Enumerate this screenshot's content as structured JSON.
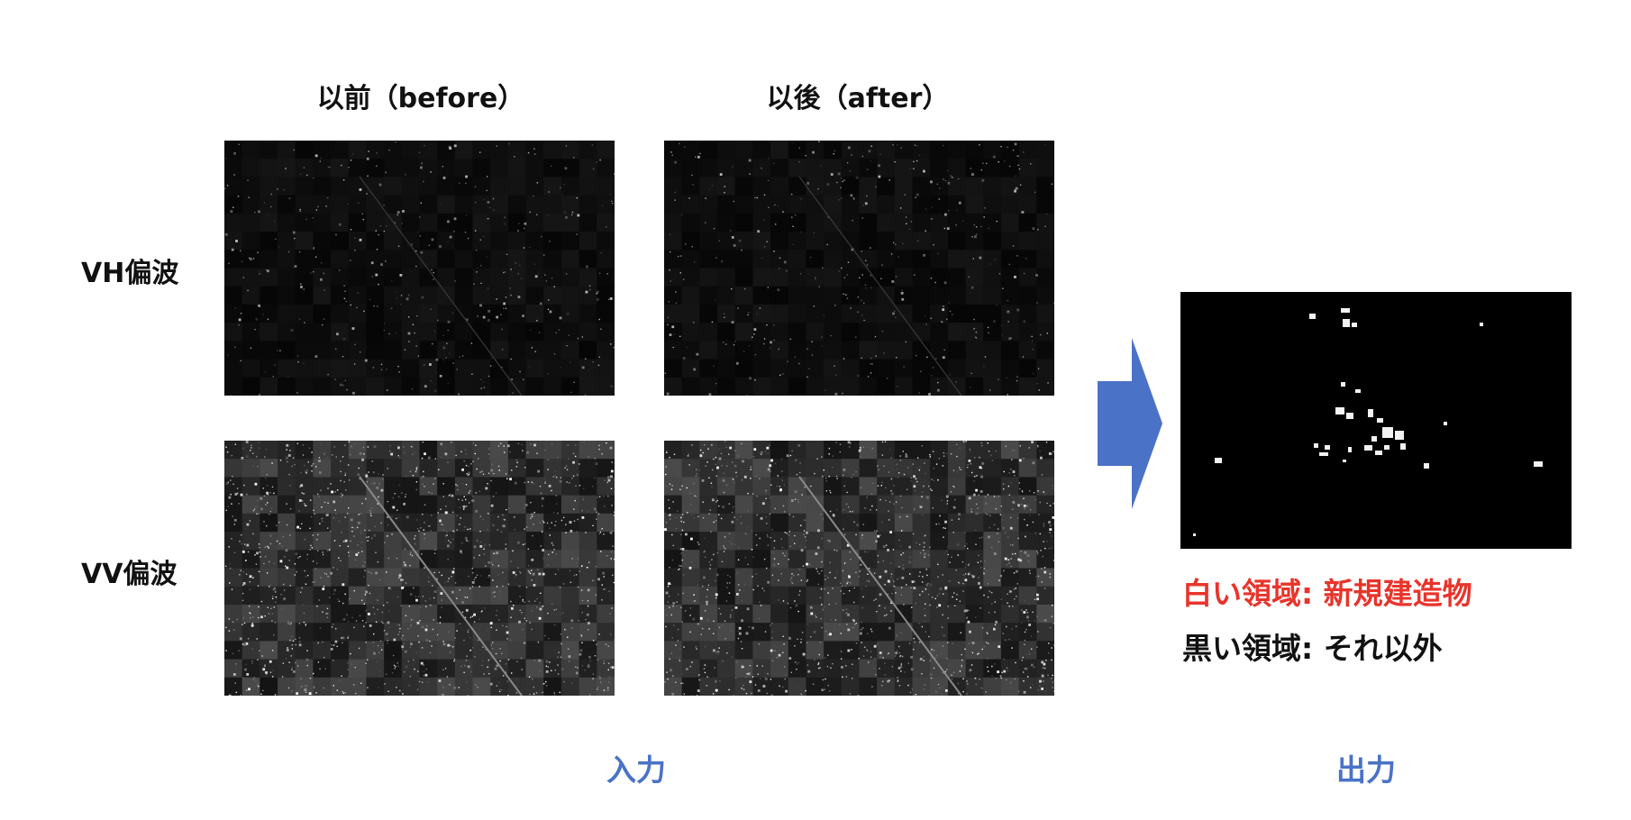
{
  "columns": {
    "before": "以前（before）",
    "after": "以後（after）"
  },
  "rows": {
    "vh": "VH偏波",
    "vv": "VV偏波"
  },
  "legend": {
    "white": "白い領域: 新規建造物",
    "black": "黒い領域: それ以外",
    "white_color": "#e8342b",
    "black_color": "#111111"
  },
  "footer": {
    "input": "入力",
    "output": "出力",
    "color": "#4a72c6"
  },
  "arrow_color": "#4a72c6"
}
